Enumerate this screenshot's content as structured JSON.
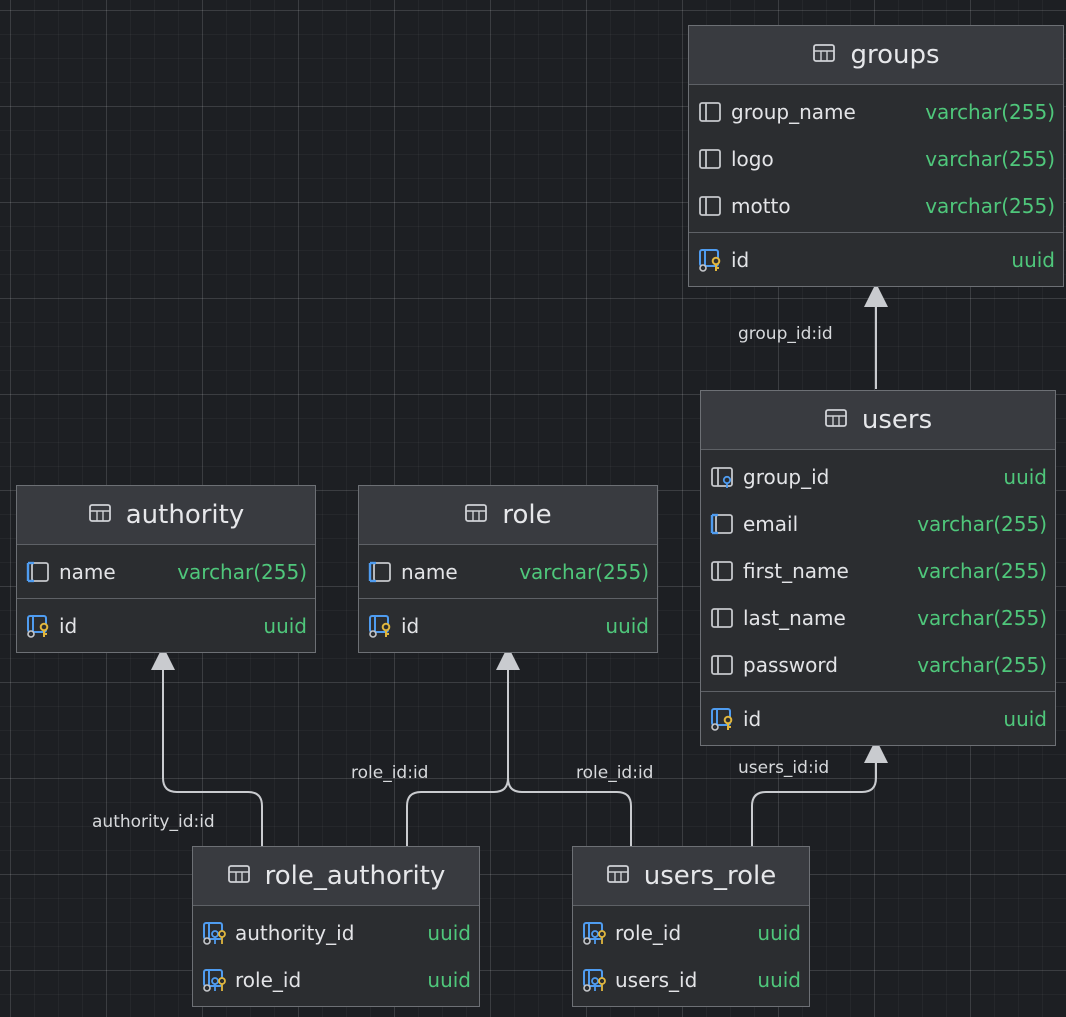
{
  "tables": {
    "groups": {
      "name": "groups",
      "columns": [
        {
          "name": "group_name",
          "type": "varchar(255)",
          "icon": "column-icon"
        },
        {
          "name": "logo",
          "type": "varchar(255)",
          "icon": "column-icon"
        },
        {
          "name": "motto",
          "type": "varchar(255)",
          "icon": "column-icon"
        }
      ],
      "keys": [
        {
          "name": "id",
          "type": "uuid",
          "icon": "primary-key-icon"
        }
      ]
    },
    "users": {
      "name": "users",
      "columns": [
        {
          "name": "group_id",
          "type": "uuid",
          "icon": "foreign-key-column-icon"
        },
        {
          "name": "email",
          "type": "varchar(255)",
          "icon": "indexed-column-icon"
        },
        {
          "name": "first_name",
          "type": "varchar(255)",
          "icon": "column-icon"
        },
        {
          "name": "last_name",
          "type": "varchar(255)",
          "icon": "column-icon"
        },
        {
          "name": "password",
          "type": "varchar(255)",
          "icon": "column-icon"
        }
      ],
      "keys": [
        {
          "name": "id",
          "type": "uuid",
          "icon": "primary-key-icon"
        }
      ]
    },
    "authority": {
      "name": "authority",
      "columns": [
        {
          "name": "name",
          "type": "varchar(255)",
          "icon": "indexed-column-icon"
        }
      ],
      "keys": [
        {
          "name": "id",
          "type": "uuid",
          "icon": "primary-key-icon"
        }
      ]
    },
    "role": {
      "name": "role",
      "columns": [
        {
          "name": "name",
          "type": "varchar(255)",
          "icon": "indexed-column-icon"
        }
      ],
      "keys": [
        {
          "name": "id",
          "type": "uuid",
          "icon": "primary-key-icon"
        }
      ]
    },
    "role_authority": {
      "name": "role_authority",
      "columns": [
        {
          "name": "authority_id",
          "type": "uuid",
          "icon": "foreign-primary-key-icon"
        },
        {
          "name": "role_id",
          "type": "uuid",
          "icon": "foreign-primary-key-icon"
        }
      ],
      "keys": []
    },
    "users_role": {
      "name": "users_role",
      "columns": [
        {
          "name": "role_id",
          "type": "uuid",
          "icon": "foreign-primary-key-icon"
        },
        {
          "name": "users_id",
          "type": "uuid",
          "icon": "foreign-primary-key-icon"
        }
      ],
      "keys": []
    }
  },
  "relations": [
    {
      "from": "users",
      "to": "groups",
      "label": "group_id:id"
    },
    {
      "from": "role_authority",
      "to": "authority",
      "label": "authority_id:id"
    },
    {
      "from": "role_authority",
      "to": "role",
      "label": "role_id:id"
    },
    {
      "from": "users_role",
      "to": "role",
      "label": "role_id:id"
    },
    {
      "from": "users_role",
      "to": "users",
      "label": "users_id:id"
    }
  ],
  "colors": {
    "background": "#1d1f23",
    "table_body": "#2b2d30",
    "table_header": "#393b40",
    "type_text": "#4fc77b",
    "edge": "#c9cbcf",
    "key_icon": "#e0b63e",
    "column_icon": "#4f9cf0"
  }
}
